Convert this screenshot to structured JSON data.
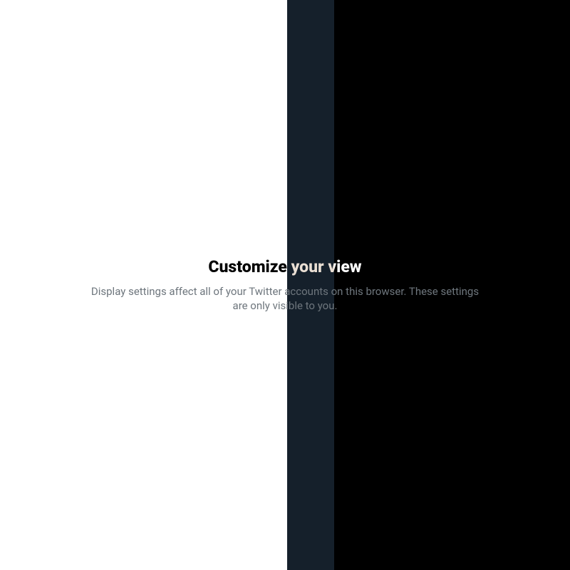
{
  "header": {
    "title": "Customize your view",
    "subtitle": "Display settings affect all of your Twitter accounts on this browser. These settings are only visible to you."
  }
}
